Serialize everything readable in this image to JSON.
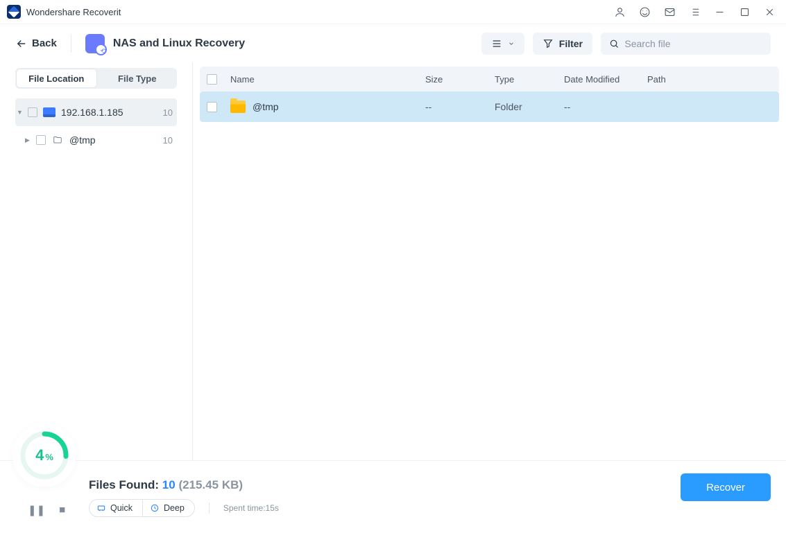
{
  "app": {
    "title": "Wondershare Recoverit"
  },
  "toolbar": {
    "back": "Back",
    "page_title": "NAS and Linux Recovery",
    "filter": "Filter",
    "search_placeholder": "Search file"
  },
  "sidebar": {
    "tabs": {
      "location": "File Location",
      "type": "File Type"
    },
    "root": {
      "label": "192.168.1.185",
      "count": "10"
    },
    "child": {
      "label": "@tmp",
      "count": "10"
    }
  },
  "table": {
    "headers": {
      "name": "Name",
      "size": "Size",
      "type": "Type",
      "date": "Date Modified",
      "path": "Path"
    },
    "rows": [
      {
        "name": "@tmp",
        "size": "--",
        "type": "Folder",
        "date": "--",
        "path": ""
      }
    ]
  },
  "footer": {
    "progress_value": "4",
    "progress_unit": "%",
    "found_label": "Files Found: ",
    "found_count": "10",
    "found_size": "(215.45 KB)",
    "mode_quick": "Quick",
    "mode_deep": "Deep",
    "spent": "Spent time:15s",
    "recover": "Recover"
  }
}
